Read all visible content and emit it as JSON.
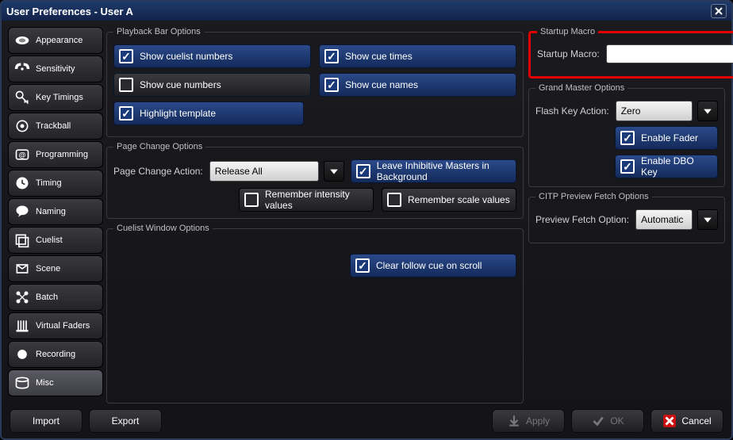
{
  "window": {
    "title": "User Preferences - User A"
  },
  "sidebar": {
    "items": [
      {
        "label": "Appearance",
        "icon": "swatch"
      },
      {
        "label": "Sensitivity",
        "icon": "signal"
      },
      {
        "label": "Key Timings",
        "icon": "key"
      },
      {
        "label": "Trackball",
        "icon": "target"
      },
      {
        "label": "Programming",
        "icon": "at"
      },
      {
        "label": "Timing",
        "icon": "clock"
      },
      {
        "label": "Naming",
        "icon": "bubble"
      },
      {
        "label": "Cuelist",
        "icon": "stack"
      },
      {
        "label": "Scene",
        "icon": "frame"
      },
      {
        "label": "Batch",
        "icon": "grid"
      },
      {
        "label": "Virtual Faders",
        "icon": "faders"
      },
      {
        "label": "Recording",
        "icon": "dot"
      },
      {
        "label": "Misc",
        "icon": "drive",
        "selected": true
      }
    ]
  },
  "playback": {
    "legend": "Playback Bar Options",
    "show_cuelist_numbers": "Show cuelist numbers",
    "show_cue_times": "Show cue times",
    "show_cue_numbers": "Show cue numbers",
    "show_cue_names": "Show cue names",
    "highlight_template": "Highlight template"
  },
  "page_change": {
    "legend": "Page Change Options",
    "action_label": "Page Change Action:",
    "action_value": "Release All",
    "leave_inhibitive": "Leave Inhibitive Masters in Background",
    "remember_intensity": "Remember intensity values",
    "remember_scale": "Remember scale values"
  },
  "cuelist_window": {
    "legend": "Cuelist Window Options",
    "clear_follow": "Clear follow cue on scroll"
  },
  "startup_macro": {
    "legend": "Startup Macro",
    "label": "Startup Macro:",
    "value": ""
  },
  "grand_master": {
    "legend": "Grand Master Options",
    "flash_label": "Flash Key Action:",
    "flash_value": "Zero",
    "enable_fader": "Enable Fader",
    "enable_dbo": "Enable DBO Key"
  },
  "citp": {
    "legend": "CITP Preview Fetch Options",
    "label": "Preview Fetch Option:",
    "value": "Automatic"
  },
  "footer": {
    "import": "Import",
    "export": "Export",
    "apply": "Apply",
    "ok": "OK",
    "cancel": "Cancel"
  }
}
